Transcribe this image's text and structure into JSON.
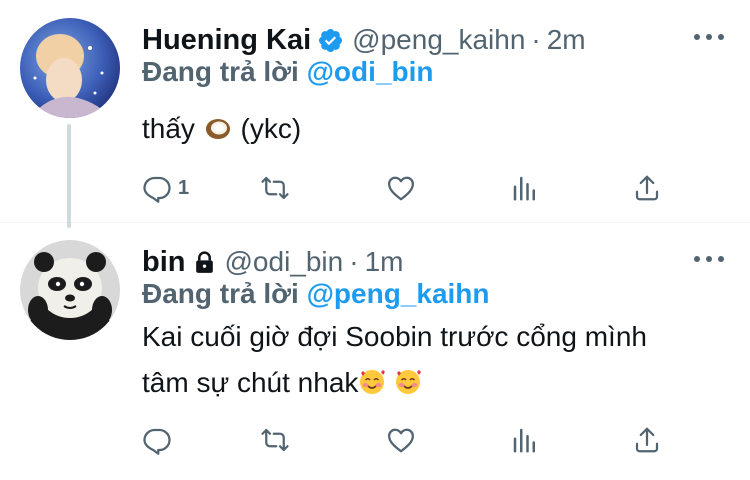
{
  "tweets": [
    {
      "name": "Huening Kai",
      "verified": true,
      "handle": "@peng_kaihn",
      "separator": "·",
      "time": "2m",
      "reply_prefix": "Đang trả lời",
      "reply_to": "@odi_bin",
      "text_before_emoji": "thấy",
      "emoji": "coconut",
      "text_after_emoji": "(ykc)",
      "reply_count": "1",
      "colors": {
        "accent": "#1d9bf0",
        "muted": "#536471"
      }
    },
    {
      "name": "bin",
      "protected": true,
      "handle": "@odi_bin",
      "separator": "·",
      "time": "1m",
      "reply_prefix": "Đang trả lời",
      "reply_to": "@peng_kaihn",
      "text_line1": "Kai cuối giờ đợi Soobin trước cổng mình",
      "text_line2": "tâm sự chút nhak",
      "emoji": "smiling-face-with-hearts"
    }
  ],
  "icons": [
    "reply-icon",
    "retweet-icon",
    "like-icon",
    "analytics-icon",
    "share-icon",
    "more-icon"
  ]
}
